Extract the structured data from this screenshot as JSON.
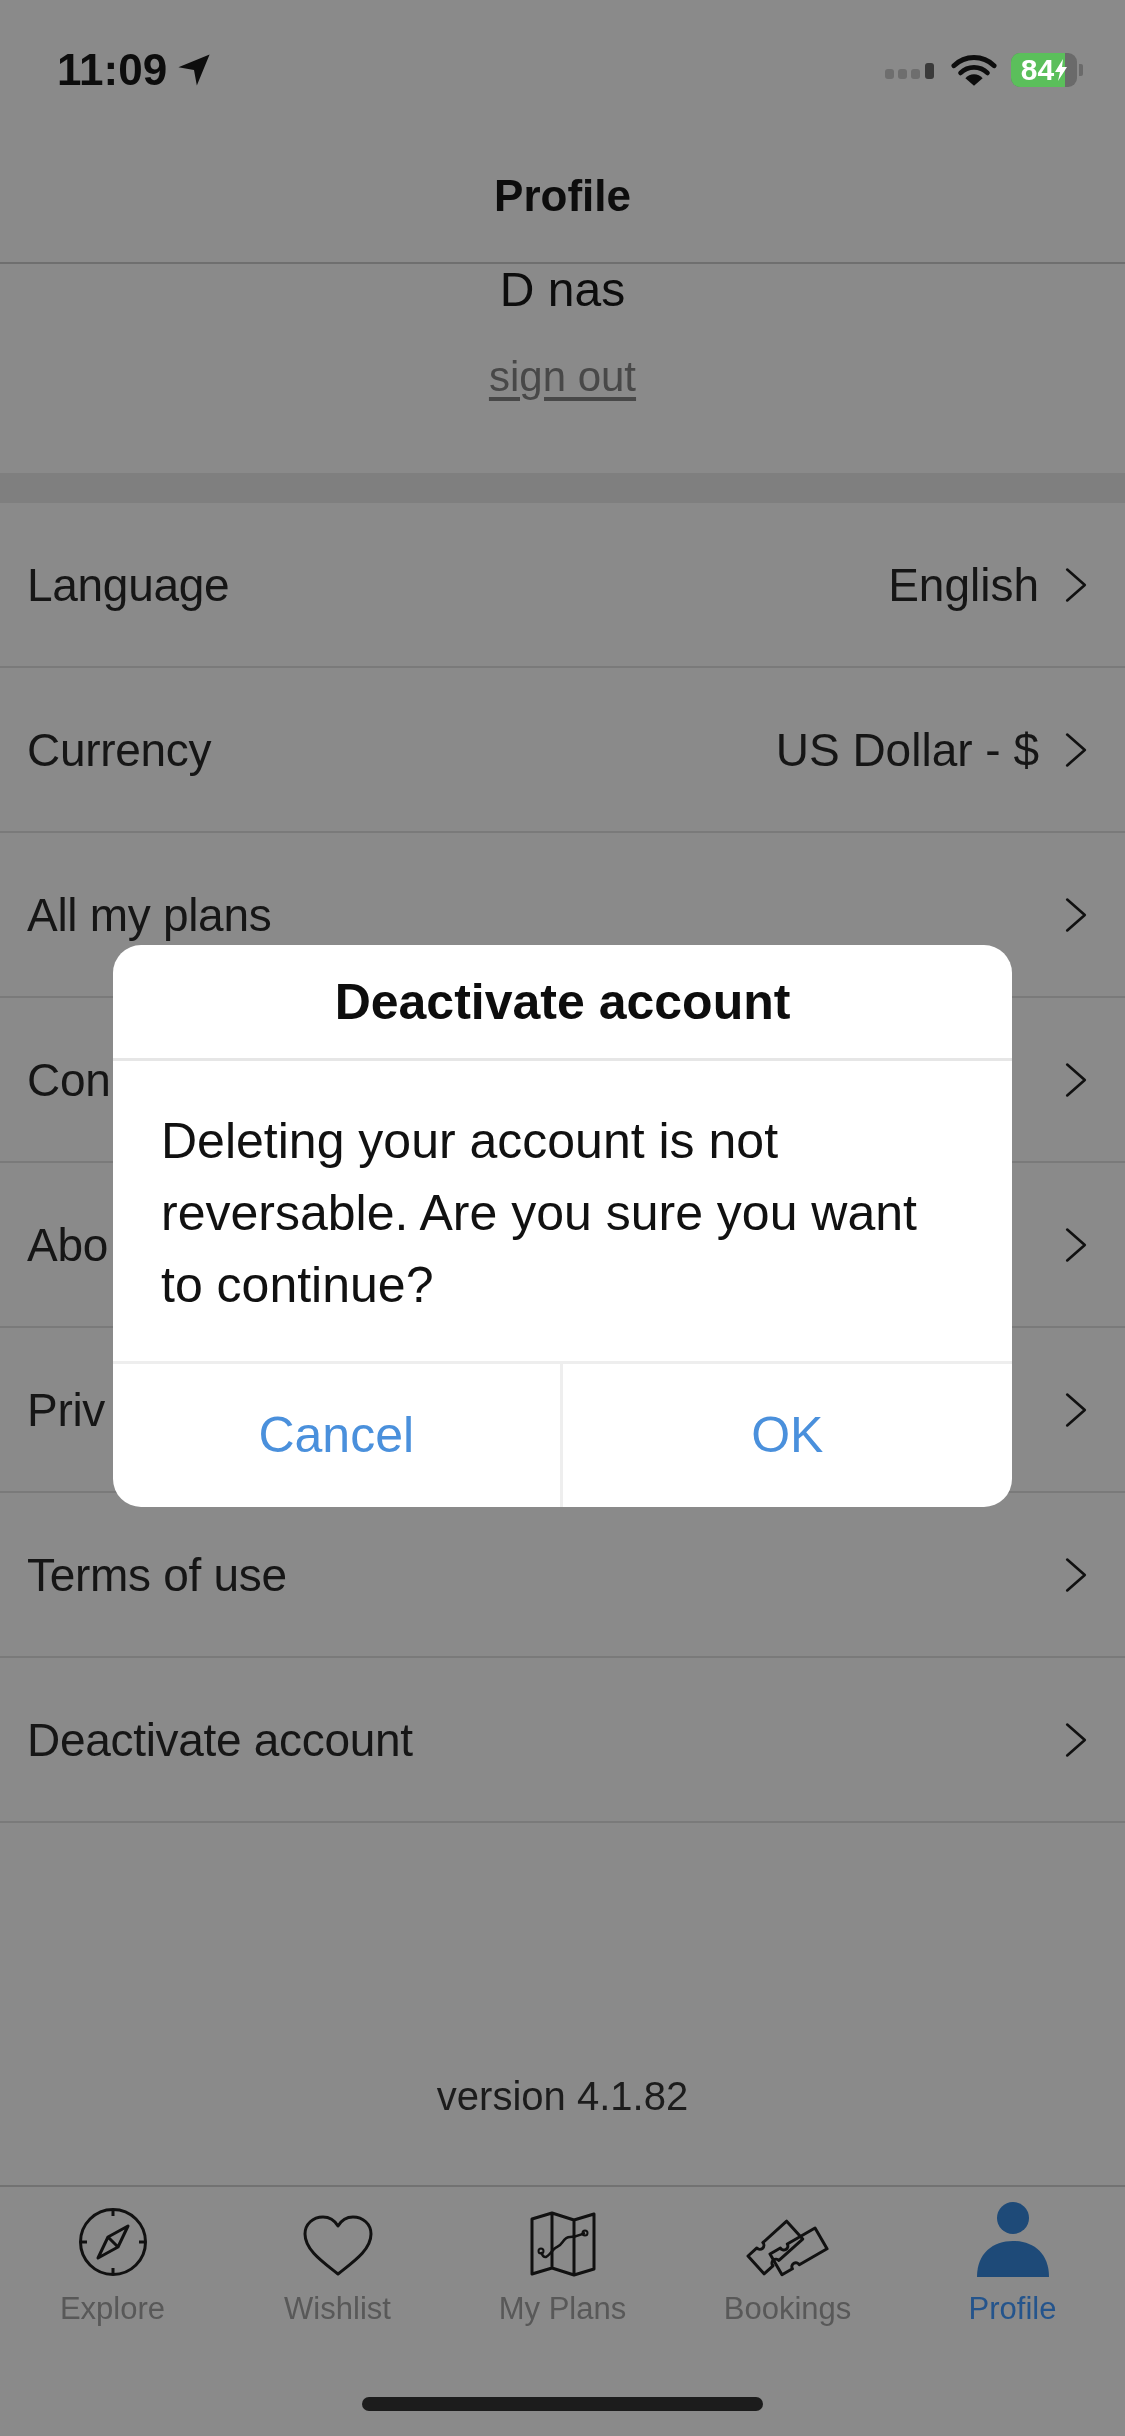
{
  "status_bar": {
    "time": "11:09",
    "battery": "84"
  },
  "header": {
    "title": "Profile",
    "name": "D nas",
    "sign_out": "sign out"
  },
  "settings": [
    {
      "label": "Language",
      "value": "English"
    },
    {
      "label": "Currency",
      "value": "US Dollar - $"
    },
    {
      "label": "All my plans"
    },
    {
      "label": "Con"
    },
    {
      "label": "Abo"
    },
    {
      "label": "Priv"
    },
    {
      "label": "Terms of use"
    },
    {
      "label": "Deactivate account"
    }
  ],
  "version": "version 4.1.82",
  "dialog": {
    "title": "Deactivate account",
    "message": "Deleting your account is not reversable. Are you sure you want to continue?",
    "buttons": [
      "Cancel",
      "OK"
    ]
  },
  "tabs": [
    {
      "label": "Explore",
      "selected": false
    },
    {
      "label": "Wishlist",
      "selected": false
    },
    {
      "label": "My Plans",
      "selected": false
    },
    {
      "label": "Bookings",
      "selected": false
    },
    {
      "label": "Profile",
      "selected": true
    }
  ]
}
